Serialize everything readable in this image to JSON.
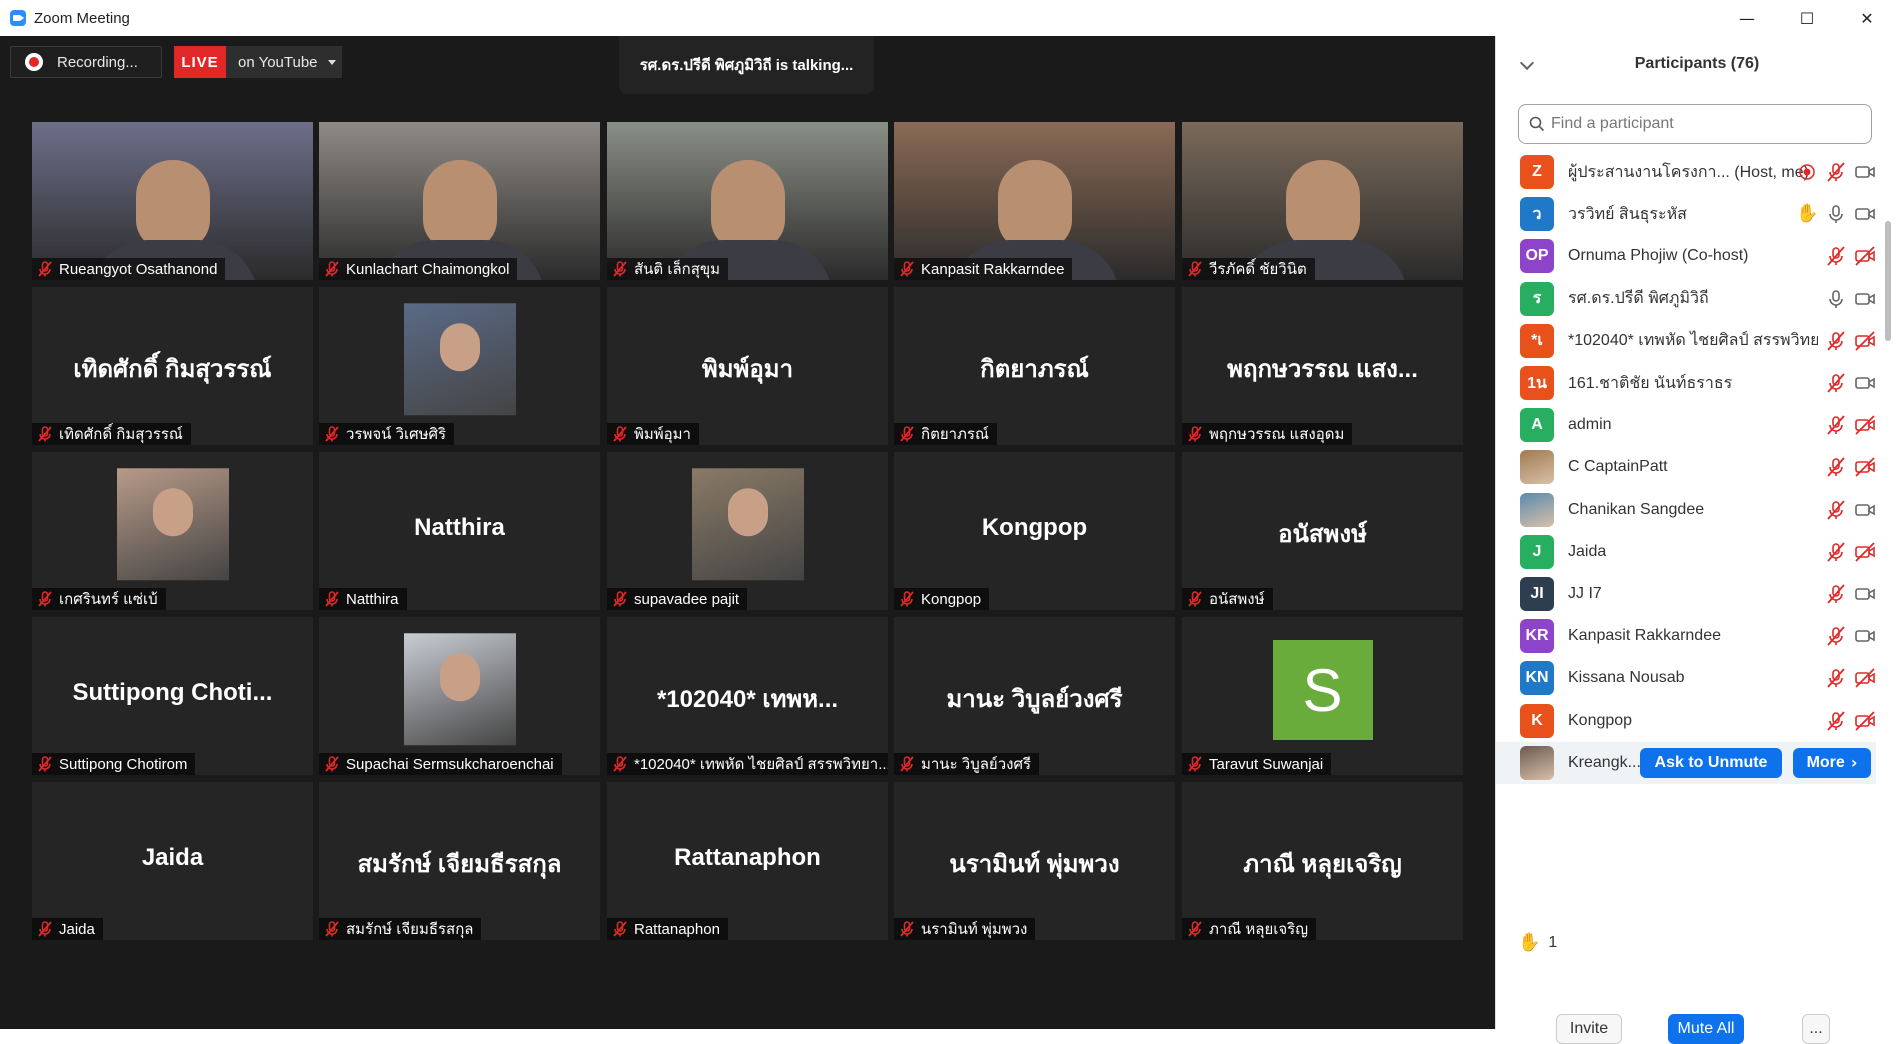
{
  "window": {
    "title": "Zoom Meeting",
    "minimize": "—",
    "maximize": "☐",
    "close": "✕"
  },
  "meeting": {
    "recording_label": "Recording...",
    "live_label": "LIVE",
    "stream_label": "on YouTube",
    "talking_banner": "รศ.ดร.ปรีดี พิศภูมิวิถี is  talking..."
  },
  "tiles": [
    {
      "name": "Rueangyot Osathanond",
      "kind": "video",
      "bg": "#6d6f8a"
    },
    {
      "name": "Kunlachart Chaimongkol",
      "kind": "video",
      "bg": "#8e8a86"
    },
    {
      "name": "สันติ เล็กสุขุม",
      "kind": "video",
      "bg": "#8a8f86"
    },
    {
      "name": "Kanpasit Rakkarndee",
      "kind": "video",
      "bg": "#8a6a55"
    },
    {
      "name": "วีรภัคดิ์ ชัยวินิต",
      "kind": "video",
      "bg": "#7a6a5a"
    },
    {
      "name": "เทิดศักดิ์ กิมสุวรรณ์",
      "kind": "text",
      "big": "เทิดศักดิ์ กิมสุวรรณ์"
    },
    {
      "name": "วรพจน์ วิเศษศิริ",
      "kind": "photo",
      "bg": "#5a6a86"
    },
    {
      "name": "พิมพ์อุมา",
      "kind": "text",
      "big": "พิมพ์อุมา"
    },
    {
      "name": "กิตยาภรณ์",
      "kind": "text",
      "big": "กิตยาภรณ์"
    },
    {
      "name": "พฤกษวรรณ แสงอุดม",
      "kind": "text",
      "big": "พฤกษวรรณ แสง..."
    },
    {
      "name": "เกศรินทร์ แซ่เบ้",
      "kind": "photo",
      "bg": "#b89a88"
    },
    {
      "name": "Natthira",
      "kind": "text",
      "big": "Natthira"
    },
    {
      "name": "supavadee  pajit",
      "kind": "photo",
      "bg": "#8a7a66"
    },
    {
      "name": "Kongpop",
      "kind": "text",
      "big": "Kongpop"
    },
    {
      "name": "อนัสพงษ์",
      "kind": "text",
      "big": "อนัสพงษ์"
    },
    {
      "name": "Suttipong Chotirom",
      "kind": "text",
      "big": "Suttipong  Choti..."
    },
    {
      "name": "Supachai Sermsukcharoenchai",
      "kind": "photo",
      "bg": "#c9cdd4"
    },
    {
      "name": "*102040* เทพหัด ไชยศิลป์ สรรพวิทยา...",
      "kind": "text",
      "big": "*102040* เทพห..."
    },
    {
      "name": "มานะ วิบูลย์วงศรี",
      "kind": "text",
      "big": "มานะ วิบูลย์วงศรี"
    },
    {
      "name": "Taravut Suwanjai",
      "kind": "letter",
      "big": "S"
    },
    {
      "name": "Jaida",
      "kind": "text",
      "big": "Jaida"
    },
    {
      "name": "สมรักษ์ เจียมธีรสกุล",
      "kind": "text",
      "big": "สมรักษ์ เจียมธีรสกุล"
    },
    {
      "name": "Rattanaphon",
      "kind": "text",
      "big": "Rattanaphon"
    },
    {
      "name": "นรามินท์ พุ่มพวง",
      "kind": "text",
      "big": "นรามินท์ พุ่มพวง"
    },
    {
      "name": "ภาณี หลุยเจริญ",
      "kind": "text",
      "big": "ภาณี หลุยเจริญ"
    }
  ],
  "panel": {
    "title": "Participants (76)",
    "search_placeholder": "Find a participant",
    "participants": [
      {
        "initials": "Z",
        "color": "#e8511c",
        "name": "ผู้ประสานงานโครงกา...  (Host, me)",
        "rec": true,
        "mic": "off",
        "cam": "on"
      },
      {
        "initials": "ว",
        "color": "#1f78c8",
        "name": "วรวิทย์  สินธุระหัส",
        "hand": true,
        "mic": "on",
        "cam": "on"
      },
      {
        "initials": "OP",
        "color": "#8e44c9",
        "name": "Ornuma Phojiw (Co-host)",
        "mic": "off",
        "cam": "off"
      },
      {
        "initials": "ร",
        "color": "#27ae60",
        "name": "รศ.ดร.ปรีดี พิศภูมิวิถี",
        "mic": "on",
        "cam": "on"
      },
      {
        "initials": "*เ",
        "color": "#e8511c",
        "name": "*102040* เทพหัด ไชยศิลป์ สรรพวิทย...",
        "mic": "off",
        "cam": "off"
      },
      {
        "initials": "1น",
        "color": "#e8511c",
        "name": "161.ชาติชัย นันท์ธราธร",
        "mic": "off",
        "cam": "on"
      },
      {
        "initials": "A",
        "color": "#27ae60",
        "name": "admin",
        "mic": "off",
        "cam": "off"
      },
      {
        "initials": "",
        "color": "#a07a50",
        "name": "C CaptainPatt",
        "mic": "off",
        "cam": "off"
      },
      {
        "initials": "",
        "color": "#5a8ab0",
        "name": "Chanikan Sangdee",
        "mic": "off",
        "cam": "on"
      },
      {
        "initials": "J",
        "color": "#27ae60",
        "name": "Jaida",
        "mic": "off",
        "cam": "off"
      },
      {
        "initials": "JI",
        "color": "#2c3e50",
        "name": "JJ I7",
        "mic": "off",
        "cam": "on"
      },
      {
        "initials": "KR",
        "color": "#8e44c9",
        "name": "Kanpasit Rakkarndee",
        "mic": "off",
        "cam": "on"
      },
      {
        "initials": "KN",
        "color": "#1f78c8",
        "name": "Kissana Nousab",
        "mic": "off",
        "cam": "off"
      },
      {
        "initials": "K",
        "color": "#e8511c",
        "name": "Kongpop",
        "mic": "off",
        "cam": "off"
      },
      {
        "initials": "",
        "color": "#6a5a50",
        "name": "Kreangk...",
        "hover": true
      }
    ],
    "ask_unmute": "Ask to Unmute",
    "more": "More",
    "raise_count": "1",
    "invite": "Invite",
    "mute_all": "Mute All",
    "more_dots": "..."
  },
  "colors": {
    "accent_blue": "#0e72ed",
    "live_red": "#e02828",
    "mic_off_red": "#e02828"
  }
}
